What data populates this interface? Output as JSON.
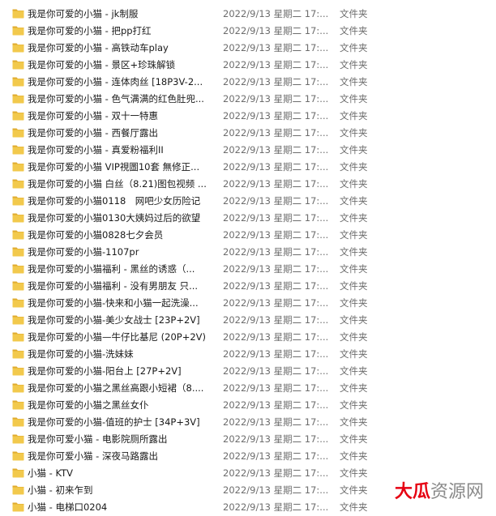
{
  "colors": {
    "folder": "#f2c94c",
    "folder_tab": "#e0ab2e",
    "watermark_red": "#e60012",
    "watermark_gray": "#8a8a8a"
  },
  "files": [
    {
      "name": "我是你可爱的小猫 - jk制服",
      "date": "2022/9/13 星期二 17:...",
      "type": "文件夹",
      "icon": "folder-icon"
    },
    {
      "name": "我是你可爱的小猫 - 把pp打红",
      "date": "2022/9/13 星期二 17:...",
      "type": "文件夹",
      "icon": "folder-icon"
    },
    {
      "name": "我是你可爱的小猫 - 高铁动车play",
      "date": "2022/9/13 星期二 17:...",
      "type": "文件夹",
      "icon": "folder-icon"
    },
    {
      "name": "我是你可爱的小猫 - 景区+珍珠解锁",
      "date": "2022/9/13 星期二 17:...",
      "type": "文件夹",
      "icon": "folder-icon"
    },
    {
      "name": "我是你可爱的小猫 - 连体肉丝 [18P3V-2...",
      "date": "2022/9/13 星期二 17:...",
      "type": "文件夹",
      "icon": "folder-icon"
    },
    {
      "name": "我是你可爱的小猫 - 色气满满的红色肚兜...",
      "date": "2022/9/13 星期二 17:...",
      "type": "文件夹",
      "icon": "folder-icon"
    },
    {
      "name": "我是你可爱的小猫 - 双十一特惠",
      "date": "2022/9/13 星期二 17:...",
      "type": "文件夹",
      "icon": "folder-icon"
    },
    {
      "name": "我是你可爱的小猫 - 西餐厅露出",
      "date": "2022/9/13 星期二 17:...",
      "type": "文件夹",
      "icon": "folder-icon"
    },
    {
      "name": "我是你可爱的小猫 - 真爱粉福利II",
      "date": "2022/9/13 星期二 17:...",
      "type": "文件夹",
      "icon": "folder-icon"
    },
    {
      "name": "我是你可爱的小猫 VIP視圖10套 無修正...",
      "date": "2022/9/13 星期二 17:...",
      "type": "文件夹",
      "icon": "folder-icon"
    },
    {
      "name": "我是你可爱的小猫 白丝（8.21)图包视频 ...",
      "date": "2022/9/13 星期二 17:...",
      "type": "文件夹",
      "icon": "folder-icon"
    },
    {
      "name": "我是你可爱的小猫0118　网吧少女历险记",
      "date": "2022/9/13 星期二 17:...",
      "type": "文件夹",
      "icon": "folder-icon"
    },
    {
      "name": "我是你可爱的小猫0130大姨妈过后的欲望",
      "date": "2022/9/13 星期二 17:...",
      "type": "文件夹",
      "icon": "folder-icon"
    },
    {
      "name": "我是你可爱的小猫0828七夕会员",
      "date": "2022/9/13 星期二 17:...",
      "type": "文件夹",
      "icon": "folder-icon"
    },
    {
      "name": "我是你可爱的小猫-1107pr",
      "date": "2022/9/13 星期二 17:...",
      "type": "文件夹",
      "icon": "folder-icon"
    },
    {
      "name": "我是你可爱的小猫福利 - 黑丝的诱惑（...",
      "date": "2022/9/13 星期二 17:...",
      "type": "文件夹",
      "icon": "folder-icon"
    },
    {
      "name": "我是你可爱的小猫福利 - 没有男朋友 只...",
      "date": "2022/9/13 星期二 17:...",
      "type": "文件夹",
      "icon": "folder-icon"
    },
    {
      "name": "我是你可爱的小猫-快来和小猫一起洗澡...",
      "date": "2022/9/13 星期二 17:...",
      "type": "文件夹",
      "icon": "folder-icon"
    },
    {
      "name": "我是你可爱的小猫-美少女战士 [23P+2V]",
      "date": "2022/9/13 星期二 17:...",
      "type": "文件夹",
      "icon": "folder-icon"
    },
    {
      "name": "我是你可爱的小猫—牛仔比基尼 (20P+2V)",
      "date": "2022/9/13 星期二 17:...",
      "type": "文件夹",
      "icon": "folder-icon"
    },
    {
      "name": "我是你可爱的小猫-洗妹妹",
      "date": "2022/9/13 星期二 17:...",
      "type": "文件夹",
      "icon": "folder-icon"
    },
    {
      "name": "我是你可爱的小猫-阳台上 [27P+2V]",
      "date": "2022/9/13 星期二 17:...",
      "type": "文件夹",
      "icon": "folder-icon"
    },
    {
      "name": "我是你可爱的小猫之黑丝高跟小短裙（8....",
      "date": "2022/9/13 星期二 17:...",
      "type": "文件夹",
      "icon": "folder-icon"
    },
    {
      "name": "我是你可爱的小猫之黑丝女仆",
      "date": "2022/9/13 星期二 17:...",
      "type": "文件夹",
      "icon": "folder-icon"
    },
    {
      "name": "我是你可爱的小猫-值班的护士 [34P+3V]",
      "date": "2022/9/13 星期二 17:...",
      "type": "文件夹",
      "icon": "folder-icon"
    },
    {
      "name": "我是你可爱小猫 - 电影院厕所露出",
      "date": "2022/9/13 星期二 17:...",
      "type": "文件夹",
      "icon": "folder-icon"
    },
    {
      "name": "我是你可爱小猫 - 深夜马路露出",
      "date": "2022/9/13 星期二 17:...",
      "type": "文件夹",
      "icon": "folder-icon"
    },
    {
      "name": "小猫 - KTV",
      "date": "2022/9/13 星期二 17:...",
      "type": "文件夹",
      "icon": "folder-icon"
    },
    {
      "name": "小猫 - 初来乍到",
      "date": "2022/9/13 星期二 17:...",
      "type": "文件夹",
      "icon": "folder-icon"
    },
    {
      "name": "小猫 - 电梯口0204",
      "date": "2022/9/13 星期二 17:...",
      "type": "文件夹",
      "icon": "folder-icon"
    }
  ],
  "watermark": {
    "part1": "大瓜",
    "part2": "资源网"
  }
}
